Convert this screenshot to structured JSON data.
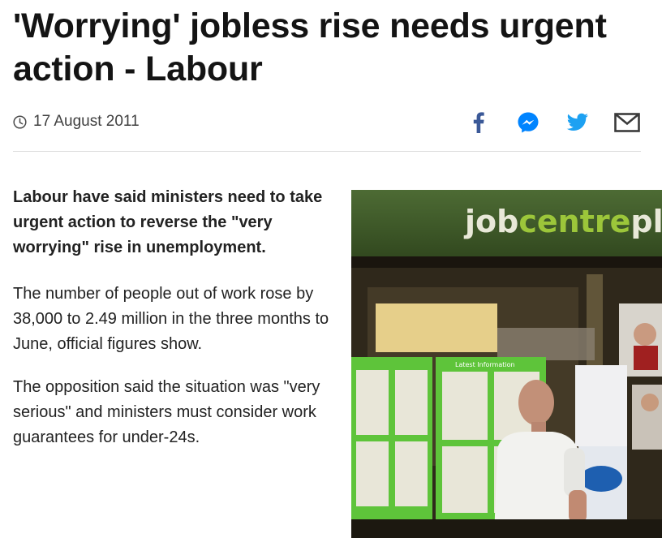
{
  "article": {
    "headline": "'Worrying' jobless rise needs urgent action - Labour",
    "date": "17 August 2011",
    "intro": "Labour have said ministers need to take urgent action to reverse the \"very worrying\" rise in unemployment.",
    "paragraphs": [
      "The number of people out of work rose by 38,000 to 2.49 million in the three months to June, official figures show.",
      "The opposition said the situation was \"very serious\" and ministers must consider work guarantees for under-24s."
    ]
  },
  "share": {
    "icons": [
      "facebook-icon",
      "messenger-icon",
      "twitter-icon",
      "email-icon"
    ],
    "colors": {
      "facebook": "#3b5998",
      "messenger": "#0084ff",
      "twitter": "#1da1f2",
      "email": "#404040"
    }
  },
  "photo": {
    "sign_text_a": "job",
    "sign_text_b": "centre",
    "sign_text_c": "plu",
    "board_label": "Latest Information",
    "colors": {
      "sign_bg": "#3d5a2a",
      "sign_text_white": "#e8e8d8",
      "sign_text_green": "#9cc63a",
      "board_green": "#5ec43a"
    }
  }
}
